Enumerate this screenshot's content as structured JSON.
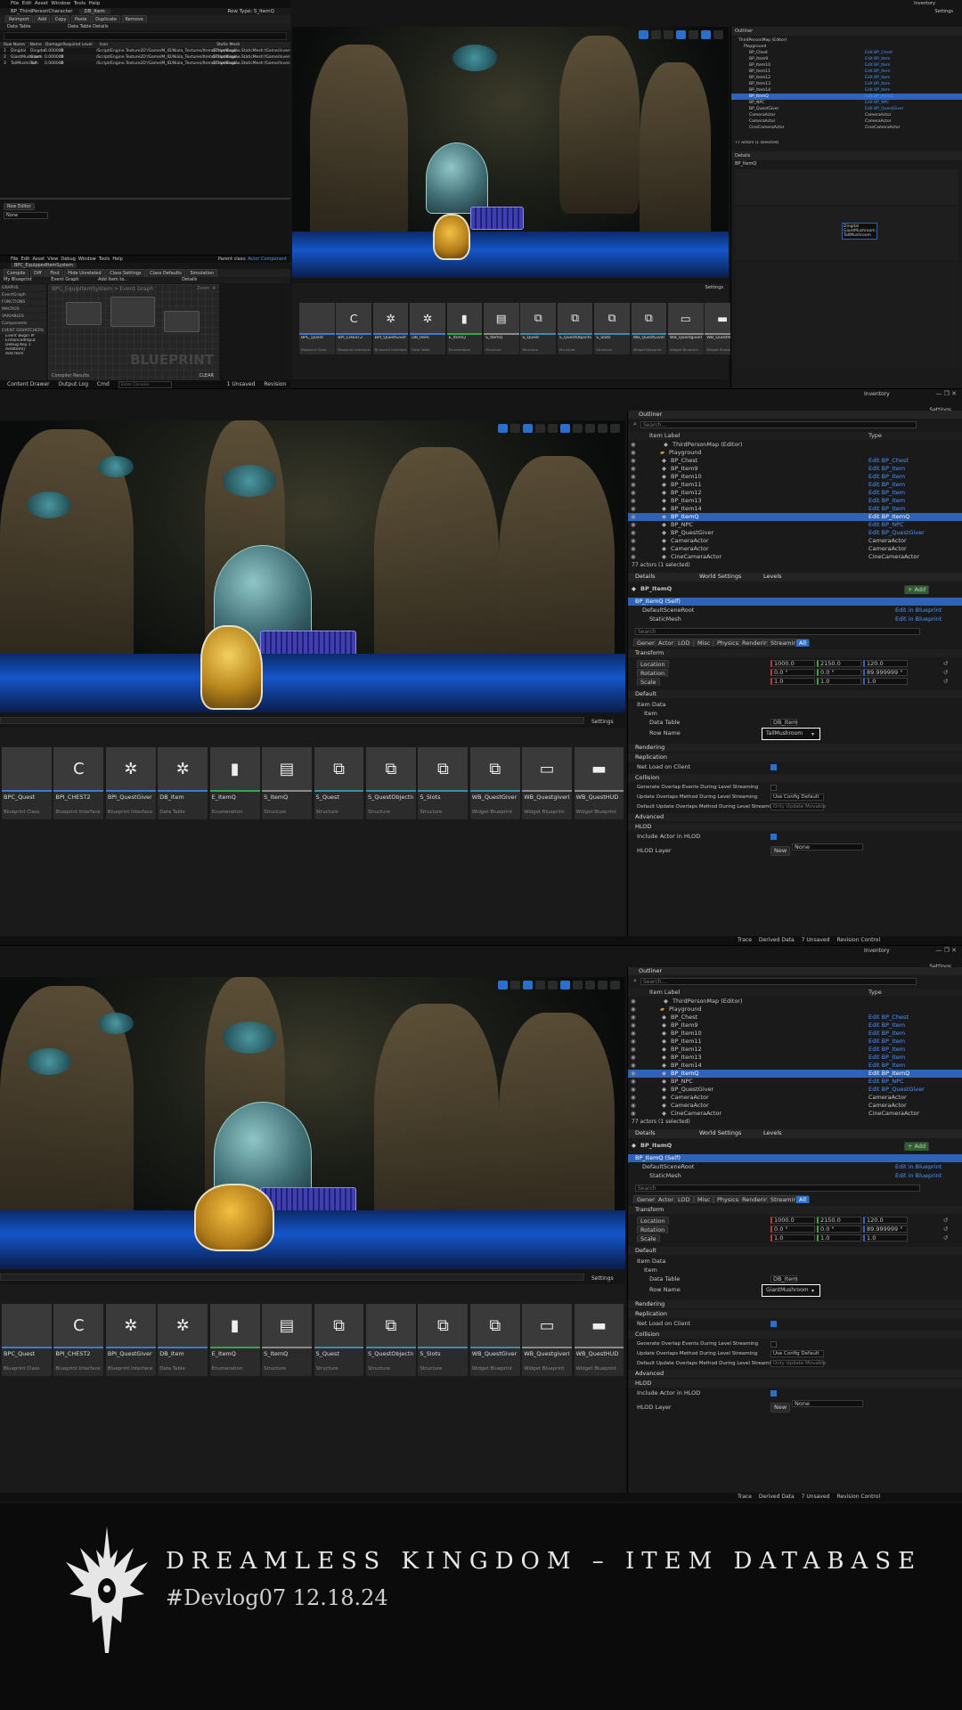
{
  "app": {
    "window_title": "Inventory",
    "settings_label": "Settings"
  },
  "p1": {
    "menu": [
      "File",
      "Edit",
      "Asset",
      "Window",
      "Tools",
      "Help"
    ],
    "tabs": [
      "BP_ThirdPersonCharacter",
      "DB_Item"
    ],
    "toolbar": [
      "Reimport",
      "Add",
      "Copy",
      "Paste",
      "Duplicate",
      "Remove"
    ],
    "row_type_label": "Row Type:",
    "row_type_value": "S_ItemQ",
    "panels": [
      "Data Table",
      "Data Table Details"
    ],
    "columns": [
      "Row Name",
      "Name",
      "Damage",
      "Required Level",
      "Icon",
      "Static Mesh"
    ],
    "rows": [
      [
        "1",
        "Dingdal",
        "Dingdal",
        "0.000000",
        "0",
        "/Script/Engine.Texture2D'/Game/M_ID/Niala_Textures/Items/Thumbnail...",
        "/Script/Engine.StaticMesh'/Game/Inventory/Models/D..."
      ],
      [
        "2",
        "GiantMushroom",
        "Giant",
        "0.000000",
        "0",
        "/Script/Engine.Texture2D'/Game/M_ID/Niala_Textures/Items/Thumbnail...",
        "/Script/Engine.StaticMesh'/Game/Inventory/Models/G..."
      ],
      [
        "3",
        "TallMushroom",
        "Tall",
        "0.000000",
        "0",
        "/Script/Engine.Texture2D'/Game/M_ID/Niala_Textures/Items/Thumbnail...",
        "/Script/Engine.StaticMesh'/Game/Inventory/Models/T..."
      ]
    ],
    "row_editor": "Row Editor",
    "row_value": "None",
    "bp_menu": [
      "File",
      "Edit",
      "Asset",
      "View",
      "Debug",
      "Window",
      "Tools",
      "Help"
    ],
    "bp_tab": "BPC_EquippedItemSystem",
    "parent_class": "Parent class:",
    "parent_value": "Actor Component",
    "bp_toolbar": [
      "Compile",
      "Diff",
      "Find",
      "Hide Unrelated",
      "Class Settings",
      "Class Defaults",
      "Simulation"
    ],
    "bp_panels": [
      "My Blueprint",
      "Event Graph",
      "Add Item to..",
      "Details"
    ],
    "breadcrumb": "BPC_EquipItemSystem > Event Graph",
    "zoom": "Zoom -4",
    "watermark": "BLUEPRINT",
    "compiler": "Compiler Results",
    "clear": "CLEAR",
    "sections": [
      "GRAPHS",
      "EventGraph",
      "FUNCTIONS",
      "MACROS",
      "VARIABLES",
      "Components",
      "EVENT DISPATCHERS"
    ],
    "mb_items": [
      "Event Begin Pl",
      "EnhancedInput",
      "Debug Key 1",
      "AddItem()",
      "Add Item"
    ],
    "status_left": [
      "Content Drawer",
      "Output Log",
      "Cmd"
    ],
    "cmd_placeholder": "Enter Console Command",
    "status_right": [
      "1 Unsaved",
      "Revision Control"
    ]
  },
  "outliner": {
    "tab": "Outliner",
    "search_placeholder": "Search...",
    "col_label": "Item Label",
    "col_type": "Type",
    "rows": [
      {
        "label": "ThirdPersonMap (Editor)",
        "type": "",
        "kind": "map"
      },
      {
        "label": "Playground",
        "type": "",
        "kind": "folder"
      },
      {
        "label": "BP_Chest",
        "type": "Edit BP_Chest",
        "kind": "bp"
      },
      {
        "label": "BP_Item9",
        "type": "Edit BP_Item",
        "kind": "bp"
      },
      {
        "label": "BP_Item10",
        "type": "Edit BP_Item",
        "kind": "bp"
      },
      {
        "label": "BP_Item11",
        "type": "Edit BP_Item",
        "kind": "bp"
      },
      {
        "label": "BP_Item12",
        "type": "Edit BP_Item",
        "kind": "bp"
      },
      {
        "label": "BP_Item13",
        "type": "Edit BP_Item",
        "kind": "bp"
      },
      {
        "label": "BP_Item14",
        "type": "Edit BP_Item",
        "kind": "bp"
      },
      {
        "label": "BP_ItemQ",
        "type": "Edit BP_ItemQ",
        "kind": "sel"
      },
      {
        "label": "BP_NPC",
        "type": "Edit BP_NPC",
        "kind": "bp"
      },
      {
        "label": "BP_QuestGiver",
        "type": "Edit BP_QuestGiver",
        "kind": "bp"
      },
      {
        "label": "CameraActor",
        "type": "CameraActor",
        "kind": "plain"
      },
      {
        "label": "CameraActor",
        "type": "CameraActor",
        "kind": "plain"
      },
      {
        "label": "CineCameraActor",
        "type": "CineCameraActor",
        "kind": "plain"
      }
    ],
    "count": "77 actors (1 selected)"
  },
  "details": {
    "tabs": [
      "Details",
      "World Settings",
      "Levels"
    ],
    "actor": "BP_ItemQ",
    "add_label": "+ Add",
    "components": [
      {
        "name": "BP_ItemQ (Self)",
        "action": ""
      },
      {
        "name": "DefaultSceneRoot",
        "action": "Edit in Blueprint"
      },
      {
        "name": "StaticMesh",
        "action": "Edit in Blueprint"
      }
    ],
    "search_placeholder": "Search",
    "filters": [
      "General",
      "Actor",
      "LOD",
      "Misc",
      "Physics",
      "Rendering",
      "Streaming",
      "All"
    ],
    "transform_label": "Transform",
    "transform": [
      {
        "name": "Location",
        "x": "1000.0",
        "y": "2150.0",
        "z": "120.0"
      },
      {
        "name": "Rotation",
        "x": "0.0 °",
        "y": "0.0 °",
        "z": "89.999999 °"
      },
      {
        "name": "Scale",
        "x": "1.0",
        "y": "1.0",
        "z": "1.0"
      }
    ],
    "default_label": "Default",
    "item_data_label": "Item Data",
    "item_label": "Item",
    "data_table_label": "Data Table",
    "data_table_value": "DB_Item",
    "row_name_label": "Row Name",
    "sections": [
      "Rendering",
      "Replication",
      "Collision",
      "Advanced",
      "HLOD"
    ],
    "net_load": "Net Load on Client",
    "collision_rows": [
      {
        "label": "Generate Overlap Events During Level Streaming",
        "value": ""
      },
      {
        "label": "Update Overlaps Method During Level Streaming",
        "value": "Use Config Default"
      },
      {
        "label": "Default Update Overlaps Method During Level Streaming",
        "value": "Only Update Movable"
      }
    ],
    "include_hlod": "Include Actor in HLOD",
    "hlod_layer": "HLOD Layer",
    "hlod_value": "None",
    "new_label": "New"
  },
  "p2": {
    "row_name": "TallMushroom"
  },
  "p3": {
    "row_name": "GiantMushroom"
  },
  "p1_dropdown": [
    "Dingdal",
    "GiantMushroom",
    "TallMushroom"
  ],
  "content": {
    "settings": "Settings",
    "tiles": [
      {
        "name": "BPC_Quest",
        "type": "Blueprint Class",
        "glyph": "",
        "bar": "#3a7bd5"
      },
      {
        "name": "BPI_CHEST2",
        "type": "Blueprint Interface",
        "glyph": "C",
        "bar": "#3a7bd5"
      },
      {
        "name": "BPI_QuestGiver",
        "type": "Blueprint Interface",
        "glyph": "✲",
        "bar": "#3a7bd5"
      },
      {
        "name": "DB_Item",
        "type": "Data Table",
        "glyph": "✲",
        "bar": "#3a7bd5"
      },
      {
        "name": "E_ItemQ",
        "type": "Enumeration",
        "glyph": "▮",
        "bar": "#2fa84f"
      },
      {
        "name": "S_ItemQ",
        "type": "Structure",
        "glyph": "▤",
        "bar": "#8a8a8a"
      },
      {
        "name": "S_Quest",
        "type": "Structure",
        "glyph": "⧉",
        "bar": "#3a8fb0"
      },
      {
        "name": "S_QuestObjective",
        "type": "Structure",
        "glyph": "⧉",
        "bar": "#3a8fb0"
      },
      {
        "name": "S_Slots",
        "type": "Structure",
        "glyph": "⧉",
        "bar": "#3a8fb0"
      },
      {
        "name": "WB_QuestGiver",
        "type": "Widget Blueprint",
        "glyph": "⧉",
        "bar": "#3a8fb0"
      },
      {
        "name": "WB_QuestgiverDialouge",
        "type": "Widget Blueprint",
        "glyph": "▭",
        "bar": "#8a8a8a"
      },
      {
        "name": "WB_QuestHUD",
        "type": "Widget Blueprint",
        "glyph": "▬",
        "bar": "#8a8a8a"
      }
    ],
    "status": [
      "Trace",
      "Derived Data",
      "7 Unsaved",
      "Revision Control"
    ]
  },
  "banner": {
    "title": "DREAMLESS KINGDOM – ITEM DATABASE",
    "subtitle": "#Devlog07 12.18.24"
  }
}
